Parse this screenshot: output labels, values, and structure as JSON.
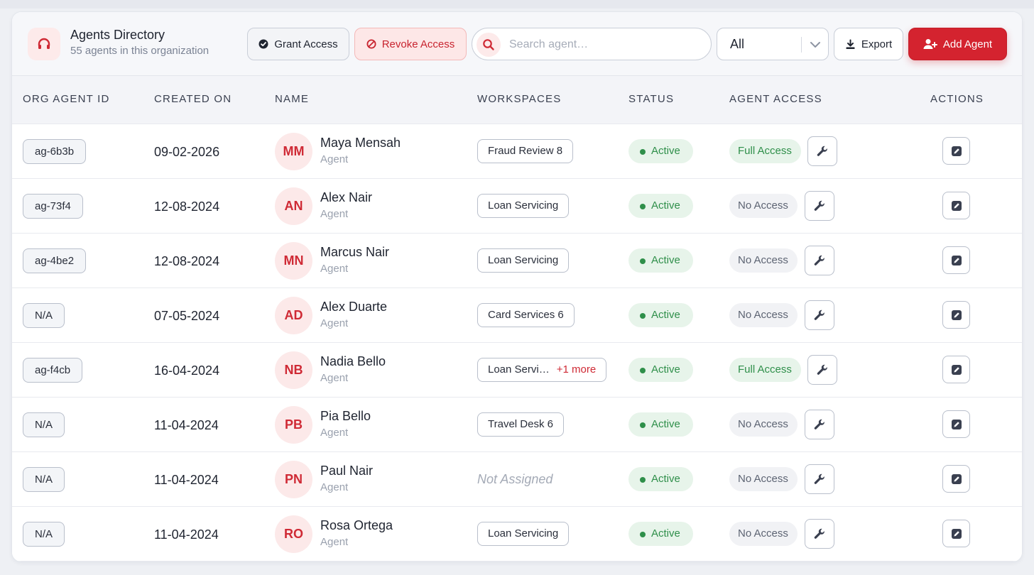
{
  "header": {
    "title": "Agents Directory",
    "subtitle": "55 agents in this organization",
    "grant_label": "Grant Access",
    "revoke_label": "Revoke Access",
    "search_placeholder": "Search agent…",
    "filter_value": "All",
    "export_label": "Export",
    "add_label": "Add Agent"
  },
  "columns": {
    "id": "ORG AGENT ID",
    "created": "CREATED ON",
    "name": "NAME",
    "workspaces": "WORKSPACES",
    "status": "STATUS",
    "access": "AGENT ACCESS",
    "actions": "ACTIONS"
  },
  "colors": {
    "accent": "#d4232f",
    "active_green": "#2f8f4a"
  },
  "rows": [
    {
      "id": "ag-6b3b",
      "created": "09-02-2026",
      "initials": "MM",
      "name": "Maya Mensah",
      "role": "Agent",
      "workspace": "Fraud Review 8",
      "more": "",
      "status": "Active",
      "access": "Full Access"
    },
    {
      "id": "ag-73f4",
      "created": "12-08-2024",
      "initials": "AN",
      "name": "Alex Nair",
      "role": "Agent",
      "workspace": "Loan Servicing",
      "more": "",
      "status": "Active",
      "access": "No Access"
    },
    {
      "id": "ag-4be2",
      "created": "12-08-2024",
      "initials": "MN",
      "name": "Marcus Nair",
      "role": "Agent",
      "workspace": "Loan Servicing",
      "more": "",
      "status": "Active",
      "access": "No Access"
    },
    {
      "id": "N/A",
      "created": "07-05-2024",
      "initials": "AD",
      "name": "Alex Duarte",
      "role": "Agent",
      "workspace": "Card Services 6",
      "more": "",
      "status": "Active",
      "access": "No Access"
    },
    {
      "id": "ag-f4cb",
      "created": "16-04-2024",
      "initials": "NB",
      "name": "Nadia Bello",
      "role": "Agent",
      "workspace": "Loan Servi…",
      "more": "+1 more",
      "status": "Active",
      "access": "Full Access"
    },
    {
      "id": "N/A",
      "created": "11-04-2024",
      "initials": "PB",
      "name": "Pia Bello",
      "role": "Agent",
      "workspace": "Travel Desk 6",
      "more": "",
      "status": "Active",
      "access": "No Access"
    },
    {
      "id": "N/A",
      "created": "11-04-2024",
      "initials": "PN",
      "name": "Paul Nair",
      "role": "Agent",
      "workspace": "",
      "workspace_empty": "Not Assigned",
      "more": "",
      "status": "Active",
      "access": "No Access"
    },
    {
      "id": "N/A",
      "created": "11-04-2024",
      "initials": "RO",
      "name": "Rosa Ortega",
      "role": "Agent",
      "workspace": "Loan Servicing",
      "more": "",
      "status": "Active",
      "access": "No Access"
    }
  ]
}
